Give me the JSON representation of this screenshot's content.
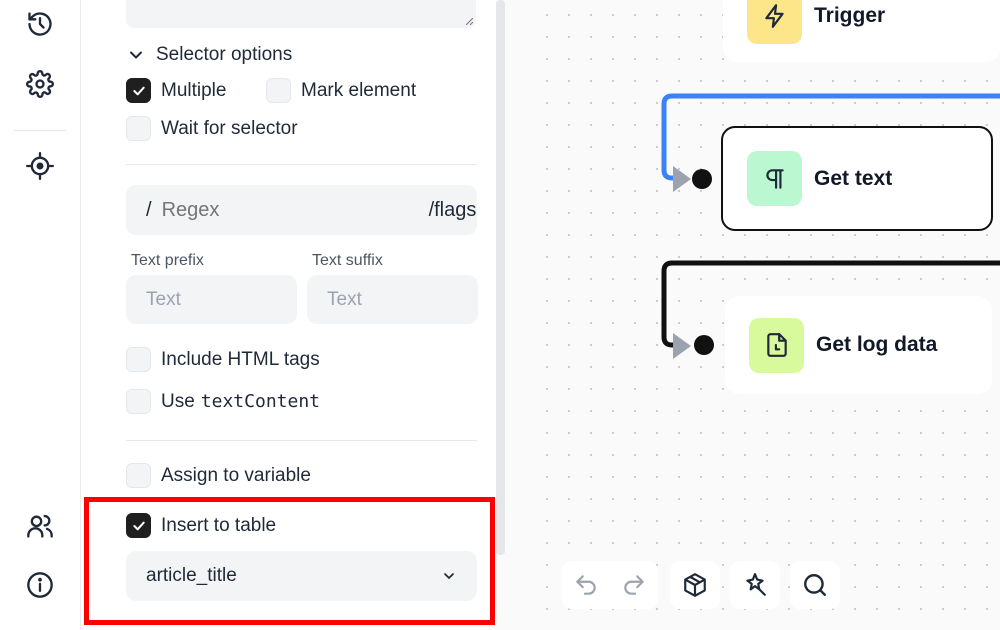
{
  "selector_options": {
    "header": "Selector options",
    "multiple": {
      "label": "Multiple",
      "checked": true
    },
    "mark_element": {
      "label": "Mark element",
      "checked": false
    },
    "wait_for_selector": {
      "label": "Wait for selector",
      "checked": false
    }
  },
  "regex": {
    "prefix": "/",
    "placeholder": "Regex",
    "flags": "/flags"
  },
  "text_prefix": {
    "label": "Text prefix",
    "placeholder": "Text"
  },
  "text_suffix": {
    "label": "Text suffix",
    "placeholder": "Text"
  },
  "include_html_tags": {
    "label": "Include HTML tags",
    "checked": false
  },
  "use_text_content": {
    "label": "Use",
    "code": "textContent",
    "checked": false
  },
  "assign_to_variable": {
    "label": "Assign to variable",
    "checked": false
  },
  "insert_to_table": {
    "label": "Insert to table",
    "checked": true
  },
  "table_column": {
    "selected": "article_title"
  },
  "nodes": [
    {
      "title": "Trigger",
      "icon": "lightning-icon",
      "color": "#fde68a"
    },
    {
      "title": "Get text",
      "icon": "pilcrow-icon",
      "color": "#bbf7d0"
    },
    {
      "title": "Get log data",
      "icon": "file-clock-icon",
      "color": "#d9f99d"
    }
  ],
  "colors": {
    "accent_blue": "#3b82f6",
    "highlight_red": "#ff0000"
  }
}
